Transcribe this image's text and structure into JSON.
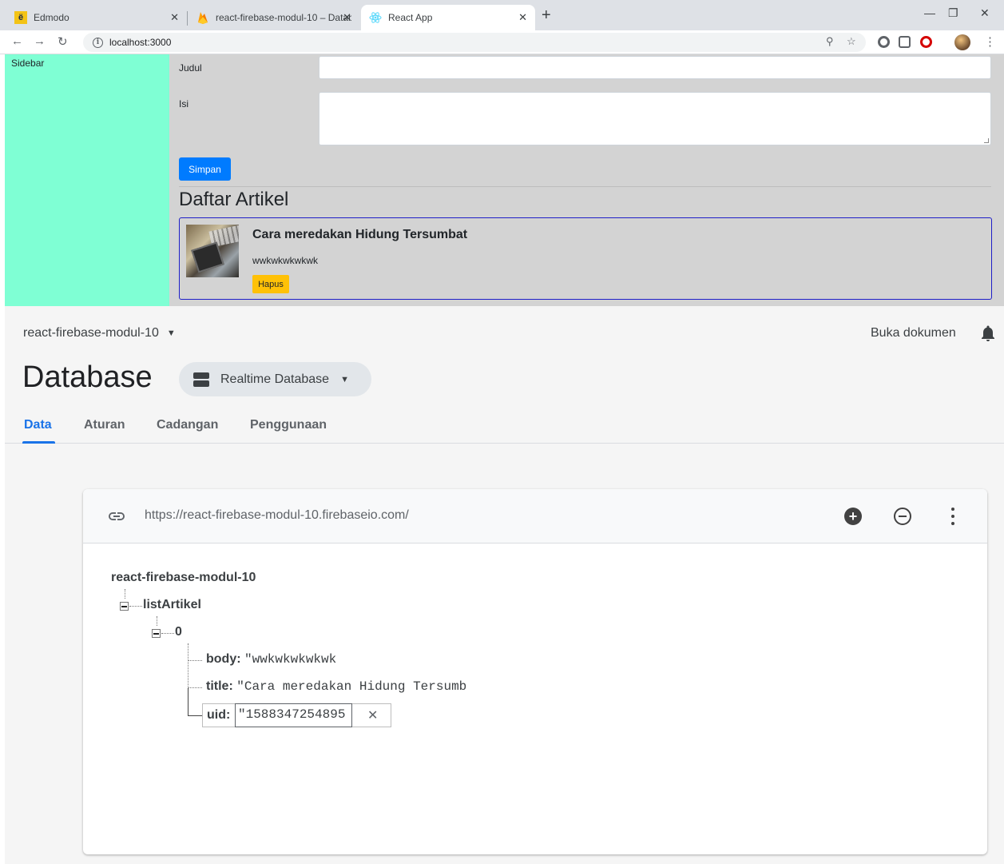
{
  "browser": {
    "tabs": [
      {
        "favicon": "ë",
        "title": "Edmodo"
      },
      {
        "favicon": "firebase",
        "title": "react-firebase-modul-10 – Datab"
      },
      {
        "favicon": "react",
        "title": "React App"
      }
    ],
    "url": "localhost:3000"
  },
  "app": {
    "sidebar_label": "Sidebar",
    "form": {
      "judul_label": "Judul",
      "isi_label": "Isi",
      "judul_value": "",
      "isi_value": "",
      "save_label": "Simpan"
    },
    "list_heading": "Daftar Artikel",
    "article": {
      "title": "Cara meredakan Hidung Tersumbat",
      "body": "wwkwkwkwkwk",
      "delete_label": "Hapus"
    }
  },
  "firebase": {
    "project_name": "react-firebase-modul-10",
    "docs_link": "Buka dokumen",
    "page_title": "Database",
    "db_selector": "Realtime Database",
    "tabs": [
      "Data",
      "Aturan",
      "Cadangan",
      "Penggunaan"
    ],
    "db_url": "https://react-firebase-modul-10.firebaseio.com/",
    "tree": {
      "root": "react-firebase-modul-10",
      "child": "listArtikel",
      "index": "0",
      "fields": [
        {
          "key": "body:",
          "value": "\"wwkwkwkwkwk"
        },
        {
          "key": "title:",
          "value": "\"Cara meredakan Hidung Tersumb"
        }
      ],
      "edit_key": "uid:",
      "edit_value": "\"1588347254895"
    }
  },
  "colors": {
    "sidebar_bg": "#7fffd4",
    "content_bg": "#d3d3d3",
    "primary_button": "#007bff",
    "warning_button": "#ffc107",
    "firebase_accent": "#1a73e8"
  },
  "icons": [
    "back-icon",
    "forward-icon",
    "reload-icon",
    "info-icon",
    "zoom-icon",
    "star-icon",
    "link-icon",
    "add-circle-icon",
    "remove-circle-icon",
    "more-vert-icon",
    "bell-icon",
    "database-icon"
  ]
}
